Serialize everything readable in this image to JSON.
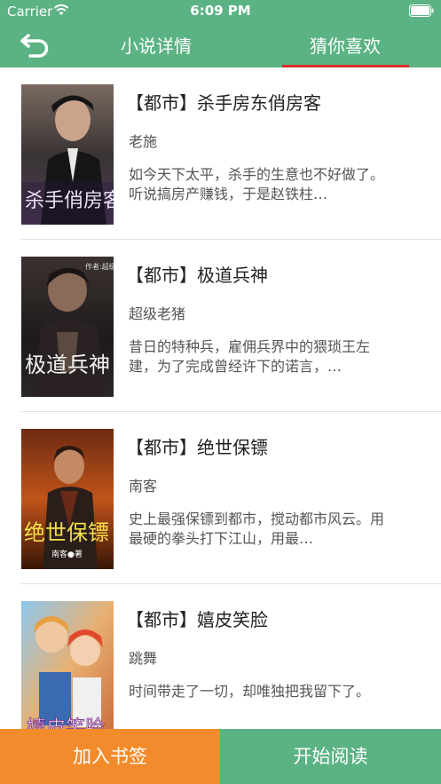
{
  "status_bar": {
    "carrier": "Carrier",
    "time": "6:09 PM"
  },
  "nav": {
    "tabs": [
      {
        "label": "小说详情",
        "active": false
      },
      {
        "label": "猜你喜欢",
        "active": true
      }
    ],
    "back_icon": "back-arrow-icon"
  },
  "books": [
    {
      "title": "【都市】杀手房东俏房客",
      "author": "老施",
      "description": "如今天下太平，杀手的生意也不好做了。听说搞房产赚钱，于是赵铁柱…",
      "cover_text": "杀手俏房客"
    },
    {
      "title": "【都市】极道兵神",
      "author": "超级老猪",
      "description": "昔日的特种兵，雇佣兵界中的猥琐王左建，为了完成曾经许下的诺言，…",
      "cover_text": "极道兵神",
      "cover_author": "作者:超级老猪"
    },
    {
      "title": "【都市】绝世保镖",
      "author": "南客",
      "description": "史上最强保镖到都市，搅动都市风云。用最硬的拳头打下江山，用最…",
      "cover_text": "绝世保镖",
      "cover_author": "南客●著"
    },
    {
      "title": "【都市】嬉皮笑脸",
      "author": "跳舞",
      "description": "时间带走了一切，却唯独把我留下了。",
      "cover_text": "嬉皮笑脸"
    }
  ],
  "bottom": {
    "bookmark_label": "加入书签",
    "read_label": "开始阅读"
  },
  "colors": {
    "primary": "#5bb384",
    "accent_orange": "#f28b2b",
    "tab_underline": "#d9302b"
  }
}
